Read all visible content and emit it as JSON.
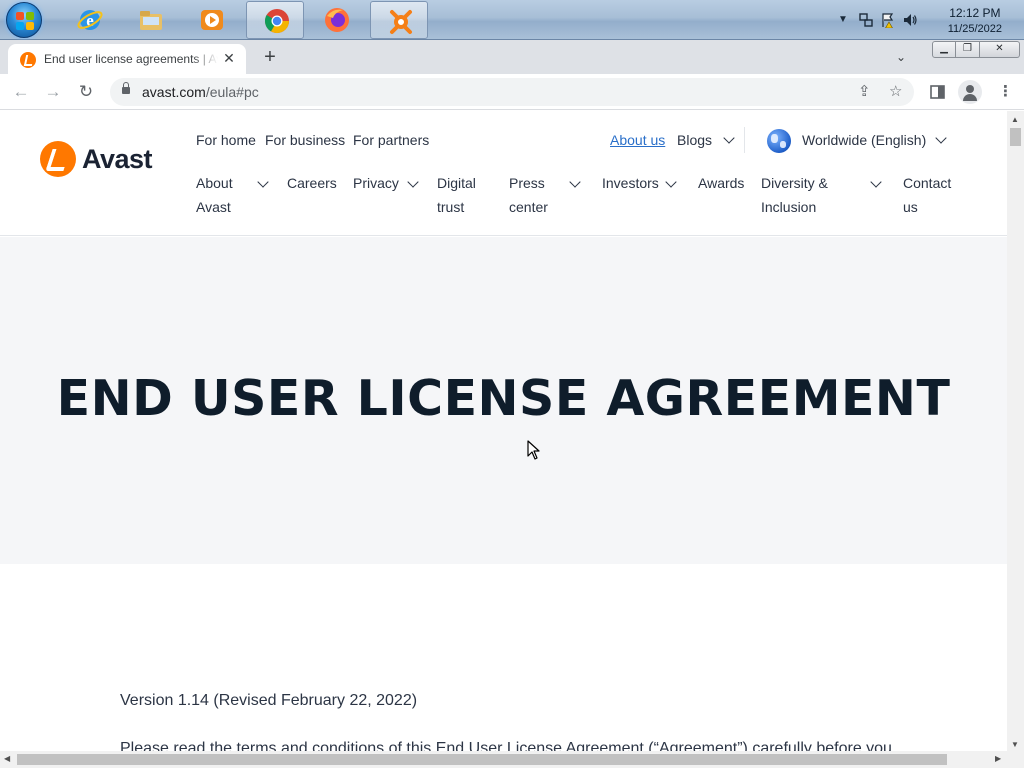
{
  "taskbar": {
    "apps": [
      {
        "name": "internet-explorer-icon"
      },
      {
        "name": "file-explorer-icon"
      },
      {
        "name": "media-player-icon"
      },
      {
        "name": "chrome-icon",
        "active": true
      },
      {
        "name": "firefox-icon"
      },
      {
        "name": "avast-icon",
        "active": true
      }
    ],
    "clock": {
      "time": "12:12 PM",
      "date": "11/25/2022"
    }
  },
  "browser": {
    "tab_title": "End user license agreements | Avast",
    "url_host": "avast.com",
    "url_path": "/eula#pc"
  },
  "site": {
    "brand": "Avast",
    "top_nav": [
      "For home",
      "For business",
      "For partners"
    ],
    "about_us": "About us",
    "blogs": "Blogs",
    "locale": "Worldwide (English)",
    "sub_nav": [
      {
        "l1": "About",
        "l2": "Avast"
      },
      {
        "l1": "Careers",
        "l2": ""
      },
      {
        "l1": "Privacy",
        "l2": ""
      },
      {
        "l1": "Digital",
        "l2": "trust"
      },
      {
        "l1": "Press",
        "l2": "center"
      },
      {
        "l1": "Investors",
        "l2": ""
      },
      {
        "l1": "Awards",
        "l2": ""
      },
      {
        "l1": "Diversity &",
        "l2": "Inclusion"
      },
      {
        "l1": "Contact",
        "l2": "us"
      }
    ]
  },
  "page": {
    "heading": "END USER LICENSE AGREEMENT",
    "version": "Version 1.14 (Revised February 22, 2022)",
    "intro": "Please read the terms and conditions of this End User License Agreement (“Agreement”) carefully before you"
  },
  "colors": {
    "brand_orange": "#ff7800",
    "link_blue": "#2a6fc9",
    "hero_bg": "#f5f6f8"
  }
}
